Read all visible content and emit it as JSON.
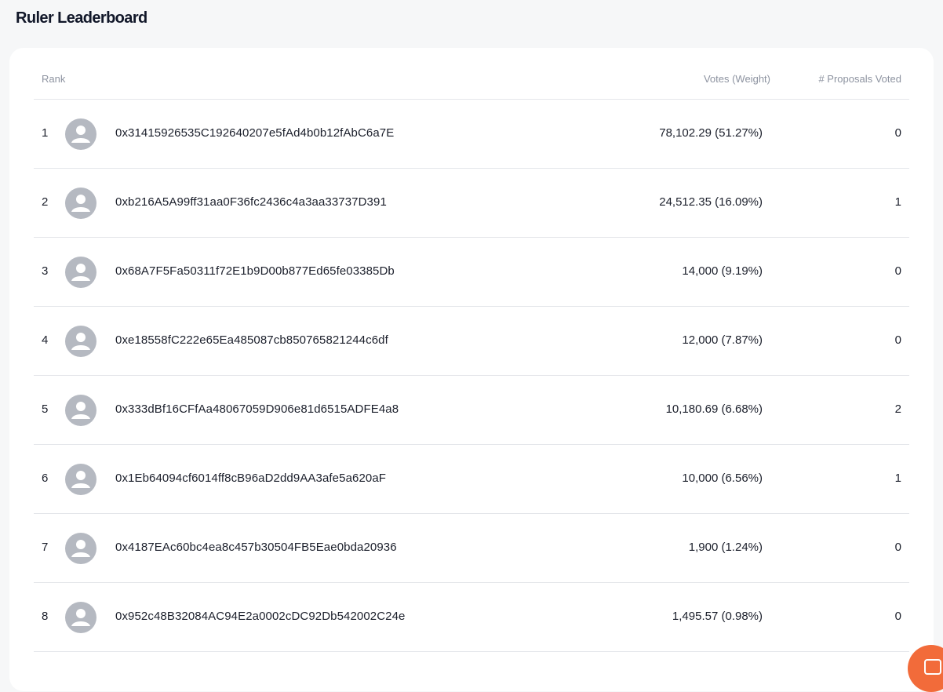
{
  "page": {
    "title": "Ruler Leaderboard"
  },
  "table": {
    "headers": {
      "rank": "Rank",
      "votes": "Votes (Weight)",
      "proposals": "# Proposals Voted"
    },
    "rows": [
      {
        "rank": "1",
        "address": "0x31415926535C192640207e5fAd4b0b12fAbC6a7E",
        "votes": "78,102.29 (51.27%)",
        "proposals": "0"
      },
      {
        "rank": "2",
        "address": "0xb216A5A99ff31aa0F36fc2436c4a3aa33737D391",
        "votes": "24,512.35 (16.09%)",
        "proposals": "1"
      },
      {
        "rank": "3",
        "address": "0x68A7F5Fa50311f72E1b9D00b877Ed65fe03385Db",
        "votes": "14,000 (9.19%)",
        "proposals": "0"
      },
      {
        "rank": "4",
        "address": "0xe18558fC222e65Ea485087cb850765821244c6df",
        "votes": "12,000 (7.87%)",
        "proposals": "0"
      },
      {
        "rank": "5",
        "address": "0x333dBf16CFfAa48067059D906e81d6515ADFE4a8",
        "votes": "10,180.69 (6.68%)",
        "proposals": "2"
      },
      {
        "rank": "6",
        "address": "0x1Eb64094cf6014ff8cB96aD2dd9AA3afe5a620aF",
        "votes": "10,000 (6.56%)",
        "proposals": "1"
      },
      {
        "rank": "7",
        "address": "0x4187EAc60bc4ea8c457b30504FB5Eae0bda20936",
        "votes": "1,900 (1.24%)",
        "proposals": "0"
      },
      {
        "rank": "8",
        "address": "0x952c48B32084AC94E2a0002cDC92Db542002C24e",
        "votes": "1,495.57 (0.98%)",
        "proposals": "0"
      }
    ]
  },
  "icons": {
    "avatar": "user-avatar-icon",
    "chat": "chat-icon"
  },
  "colors": {
    "background": "#f6f7f8",
    "card": "#ffffff",
    "avatar": "#b5b9c1",
    "chat_button": "#f26b3a",
    "muted_text": "#8d93a0"
  }
}
